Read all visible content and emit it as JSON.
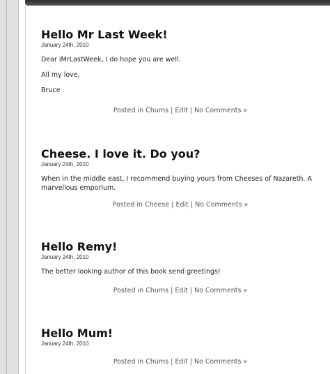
{
  "posts": [
    {
      "title": "Hello Mr Last Week!",
      "date": "January 24th, 2010",
      "paragraphs": [
        "Dear iMrLastWeek, I do hope you are well.",
        "All my love,",
        "Bruce"
      ],
      "posted_in_prefix": "Posted in ",
      "category": "Chums",
      "sep1": " | ",
      "edit": "Edit",
      "sep2": " | ",
      "comments": "No Comments »"
    },
    {
      "title": "Cheese. I love it. Do you?",
      "date": "January 24th, 2010",
      "paragraphs": [
        "When in the middle east, I recommend buying yours from Cheeses of Nazareth. A marvellous emporium."
      ],
      "posted_in_prefix": "Posted in ",
      "category": "Cheese",
      "sep1": " | ",
      "edit": "Edit",
      "sep2": " | ",
      "comments": "No Comments »"
    },
    {
      "title": "Hello Remy!",
      "date": "January 24th, 2010",
      "paragraphs": [
        "The better looking author of this book send greetings!"
      ],
      "posted_in_prefix": "Posted in ",
      "category": "Chums",
      "sep1": " | ",
      "edit": "Edit",
      "sep2": " | ",
      "comments": "No Comments »"
    },
    {
      "title": "Hello Mum!",
      "date": "January 24th, 2010",
      "paragraphs": [],
      "posted_in_prefix": "Posted in ",
      "category": "Chums",
      "sep1": " | ",
      "edit": "Edit",
      "sep2": " | ",
      "comments": "No Comments »"
    }
  ]
}
